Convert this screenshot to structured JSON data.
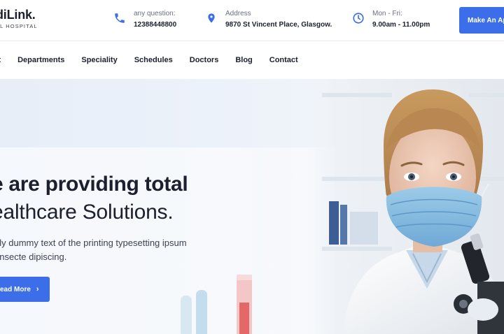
{
  "brand": {
    "name": "diLink.",
    "tagline": "AL HOSPITAL"
  },
  "header": {
    "phone": {
      "icon": "phone-icon",
      "label": "any question:",
      "value": "12388448800"
    },
    "address": {
      "icon": "map-pin-icon",
      "label": "Address",
      "value": "9870 St Vincent Place, Glasgow."
    },
    "hours": {
      "icon": "clock-icon",
      "label": "Mon - Fri:",
      "value": "9.00am - 11.00pm"
    },
    "cta_label": "Make An Appointment"
  },
  "nav": {
    "items": [
      "out",
      "Departments",
      "Speciality",
      "Schedules",
      "Doctors",
      "Blog",
      "Contact"
    ]
  },
  "hero": {
    "title_line1": "e are providing total",
    "title_line2": "ealthcare Solutions.",
    "text_line1": "ply dummy text of the printing typesetting ipsum",
    "text_line2": "onsecte dipiscing.",
    "button_label": "ead More",
    "button_icon": "chevron-right-icon"
  },
  "colors": {
    "accent": "#3b6ee8",
    "text_dark": "#1c1f2e",
    "hero_bg": "#f3f6fb"
  }
}
